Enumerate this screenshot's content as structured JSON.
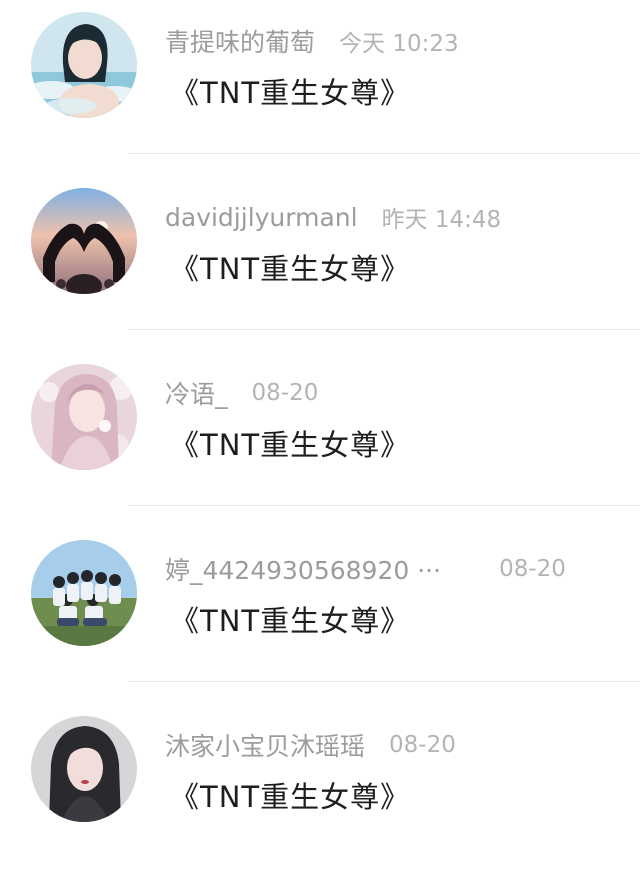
{
  "comments": [
    {
      "username": "青提味的葡萄",
      "time": "今天 10:23",
      "text": "《TNT重生女尊》",
      "avatar_icon": "avatar-girl-in-water-icon",
      "avatar_colors": [
        "#cfe6ef",
        "#8fc8da"
      ]
    },
    {
      "username": "davidjjlyurmanl",
      "time": "昨天 14:48",
      "text": "《TNT重生女尊》",
      "avatar_icon": "avatar-heart-hands-concert-icon",
      "avatar_colors": [
        "#e9b9a8",
        "#8e6f7c"
      ]
    },
    {
      "username": "冷语_",
      "time": "08-20",
      "text": "《TNT重生女尊》",
      "avatar_icon": "avatar-anime-girl-flowers-icon",
      "avatar_colors": [
        "#eed4dc",
        "#b58ea0"
      ]
    },
    {
      "username": "婷_4424930568920 ···",
      "time": "08-20",
      "text": "《TNT重生女尊》",
      "avatar_icon": "avatar-group-photo-icon",
      "avatar_colors": [
        "#9fc7e8",
        "#6c8a4c"
      ]
    },
    {
      "username": "沐家小宝贝沐瑶瑶",
      "time": "08-20",
      "text": "《TNT重生女尊》",
      "avatar_icon": "avatar-girl-portrait-icon",
      "avatar_colors": [
        "#d8d8da",
        "#2a2a2e"
      ]
    }
  ]
}
